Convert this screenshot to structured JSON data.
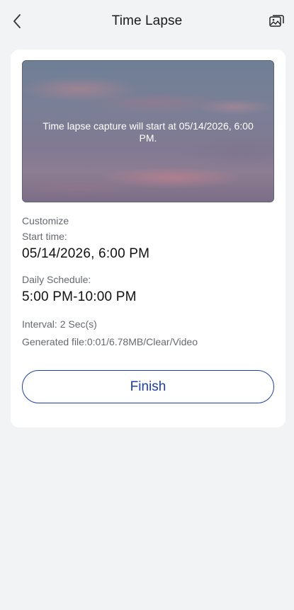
{
  "header": {
    "title": "Time Lapse",
    "back_icon": "chevron-left-icon",
    "gallery_icon": "gallery-icon"
  },
  "preview": {
    "message": "Time lapse capture will start at 05/14/2026, 6:00 PM."
  },
  "details": {
    "customize_label": "Customize",
    "start_time_label": "Start time:",
    "start_time_value": "05/14/2026, 6:00 PM",
    "daily_schedule_label": "Daily Schedule:",
    "daily_schedule_value": "5:00 PM-10:00 PM",
    "interval_text": "Interval: 2 Sec(s)",
    "generated_file_text": "Generated file:0:01/6.78MB/Clear/Video"
  },
  "actions": {
    "finish_label": "Finish"
  },
  "colors": {
    "background": "#f2f3f5",
    "card": "#ffffff",
    "accent": "#1d3fa6"
  }
}
